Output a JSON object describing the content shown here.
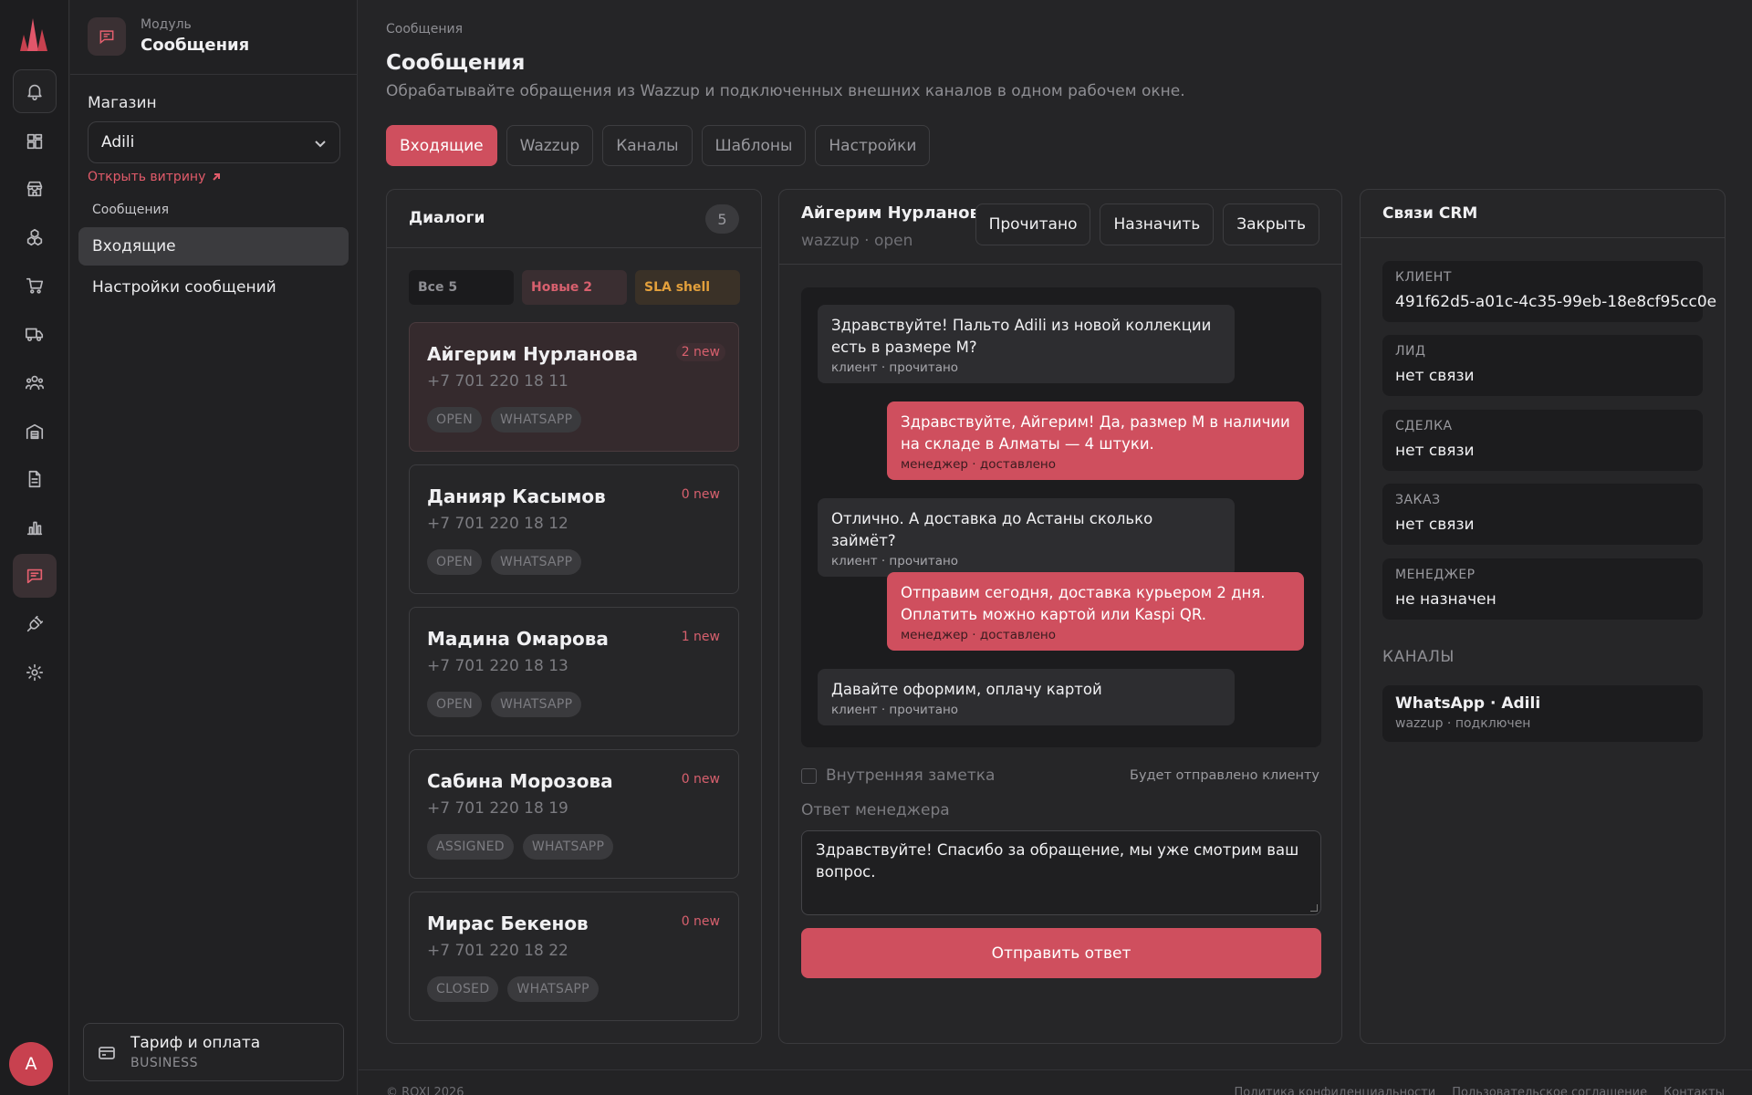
{
  "module": {
    "label": "Модуль",
    "name": "Сообщения"
  },
  "sidebar": {
    "shop_label": "Магазин",
    "shop_value": "Adili",
    "open_storefront": "Открыть витрину",
    "group": "Сообщения",
    "items": [
      {
        "label": "Входящие",
        "active": true
      },
      {
        "label": "Настройки сообщений",
        "active": false
      }
    ],
    "plan_title": "Тариф и оплата",
    "plan_sub": "BUSINESS"
  },
  "user": {
    "avatar_letter": "A"
  },
  "breadcrumb": "Сообщения",
  "page": {
    "title": "Сообщения",
    "subtitle": "Обрабатывайте обращения из Wazzup и подключенных внешних каналов в одном рабочем окне."
  },
  "tabs": [
    "Входящие",
    "Wazzup",
    "Каналы",
    "Шаблоны",
    "Настройки"
  ],
  "dialogs": {
    "title": "Диалоги",
    "count": "5",
    "filters": {
      "all": "Все 5",
      "new": "Новые 2",
      "sla": "SLA shell"
    },
    "items": [
      {
        "name": "Айгерим Нурланова",
        "phone": "+7 701 220 18 11",
        "new": "2 new",
        "status": "OPEN",
        "channel": "WHATSAPP"
      },
      {
        "name": "Данияр Касымов",
        "phone": "+7 701 220 18 12",
        "new": "0 new",
        "status": "OPEN",
        "channel": "WHATSAPP"
      },
      {
        "name": "Мадина Омарова",
        "phone": "+7 701 220 18 13",
        "new": "1 new",
        "status": "OPEN",
        "channel": "WHATSAPP"
      },
      {
        "name": "Сабина Морозова",
        "phone": "+7 701 220 18 19",
        "new": "0 new",
        "status": "ASSIGNED",
        "channel": "WHATSAPP"
      },
      {
        "name": "Мирас Бекенов",
        "phone": "+7 701 220 18 22",
        "new": "0 new",
        "status": "CLOSED",
        "channel": "WHATSAPP"
      }
    ]
  },
  "chat": {
    "name": "Айгерим Нурланова",
    "status": "wazzup · open",
    "buttons": {
      "read": "Прочитано",
      "assign": "Назначить",
      "close": "Закрыть"
    },
    "messages": [
      {
        "text": "Здравствуйте! Пальто Adili из новой коллекции есть в размере M?",
        "meta": "клиент · прочитано"
      },
      {
        "text": "Здравствуйте, Айгерим! Да, размер M в наличии на складе в Алматы — 4 штуки.",
        "meta": "менеджер · доставлено"
      },
      {
        "text": "Отлично. А доставка до Астаны сколько займёт?",
        "meta": "клиент · прочитано"
      },
      {
        "text": "Отправим сегодня, доставка курьером 2 дня. Оплатить можно картой или Kaspi QR.",
        "meta": "менеджер · доставлено"
      },
      {
        "text": "Давайте оформим, оплачу картой",
        "meta": "клиент · прочитано"
      }
    ],
    "internal_note": "Внутренняя заметка",
    "will_send": "Будет отправлено клиенту",
    "reply_label": "Ответ менеджера",
    "reply_value": "Здравствуйте! Спасибо за обращение, мы уже смотрим ваш вопрос.",
    "send": "Отправить ответ"
  },
  "crm": {
    "title": "Связи CRM",
    "fields": [
      {
        "key": "КЛИЕНТ",
        "value": "491f62d5-a01c-4c35-99eb-18e8cf95cc0e"
      },
      {
        "key": "ЛИД",
        "value": "нет связи"
      },
      {
        "key": "СДЕЛКА",
        "value": "нет связи"
      },
      {
        "key": "ЗАКАЗ",
        "value": "нет связи"
      },
      {
        "key": "МЕНЕДЖЕР",
        "value": "не назначен"
      }
    ],
    "channels_label": "КАНАЛЫ",
    "channel": {
      "name": "WhatsApp · Adili",
      "status": "wazzup · подключен"
    }
  },
  "footer": {
    "copyright": "© ROXI 2026",
    "links": [
      "Политика конфиденциальности",
      "Пользовательское соглашение",
      "Контакты"
    ]
  }
}
